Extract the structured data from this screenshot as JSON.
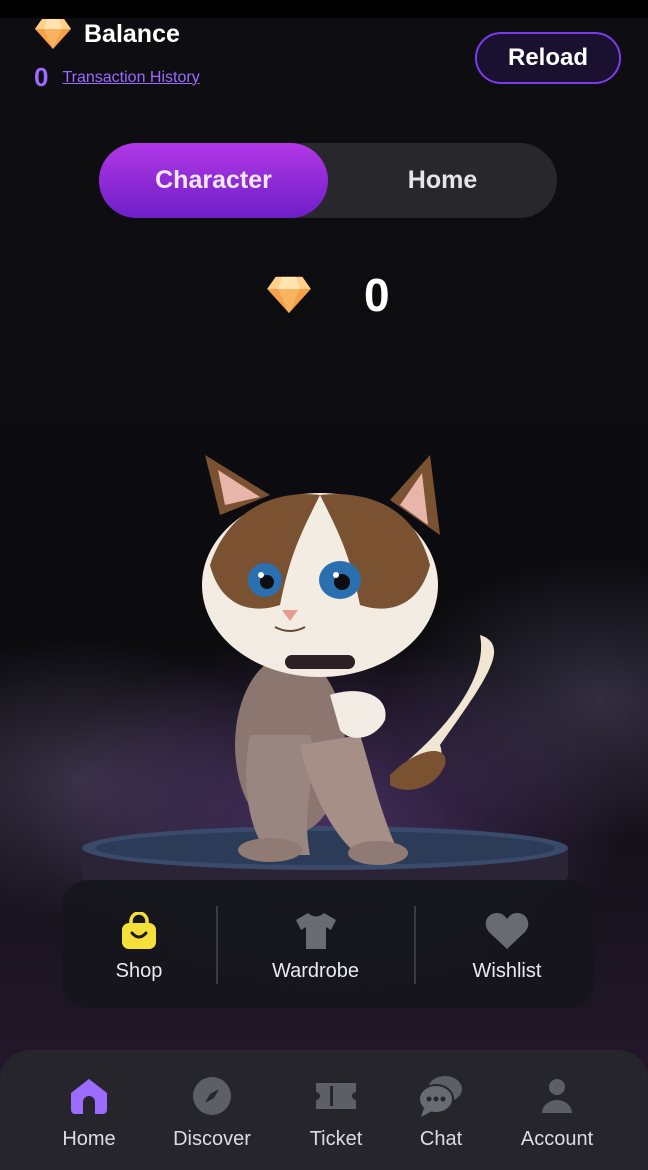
{
  "header": {
    "balance_title": "Balance",
    "balance_value": "0",
    "transaction_link": "Transaction History",
    "reload_label": "Reload"
  },
  "toggle": {
    "options": [
      {
        "label": "Character",
        "active": true
      },
      {
        "label": "Home",
        "active": false
      }
    ]
  },
  "gems": {
    "count": "0",
    "icon": "gem-icon"
  },
  "actions": [
    {
      "label": "Shop",
      "icon": "shopping-bag-icon"
    },
    {
      "label": "Wardrobe",
      "icon": "tshirt-icon"
    },
    {
      "label": "Wishlist",
      "icon": "heart-icon"
    }
  ],
  "nav": {
    "items": [
      {
        "label": "Home",
        "icon": "home-icon",
        "active": true
      },
      {
        "label": "Discover",
        "icon": "compass-icon",
        "active": false
      },
      {
        "label": "Ticket",
        "icon": "ticket-icon",
        "active": false
      },
      {
        "label": "Chat",
        "icon": "chat-icon",
        "active": false
      },
      {
        "label": "Account",
        "icon": "user-icon",
        "active": false
      }
    ]
  },
  "colors": {
    "accent": "#9b6cff",
    "toggle_active_top": "#b237e6",
    "toggle_active_bottom": "#6d1fc8",
    "shop_icon": "#f5e03a",
    "nav_active": "#9b6cff",
    "nav_inactive": "#5e5e66"
  }
}
